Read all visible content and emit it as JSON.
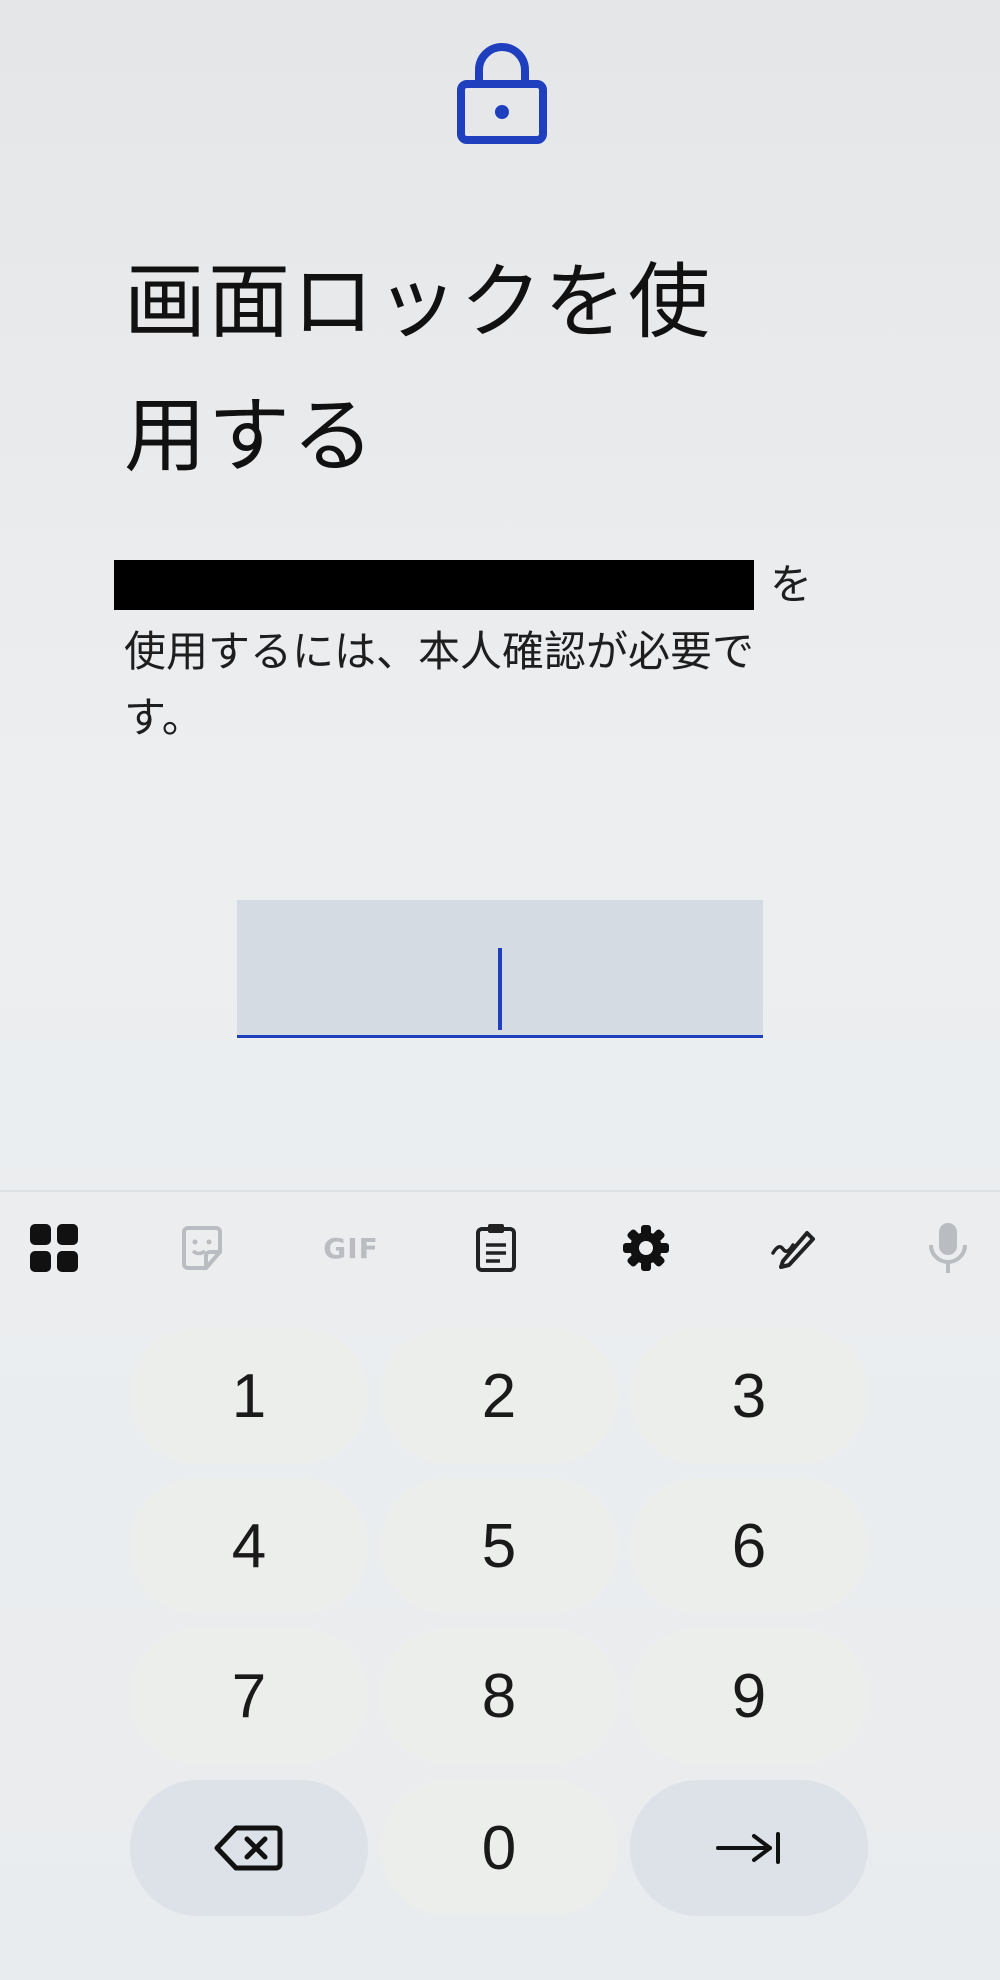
{
  "header": {
    "lock_icon": "lock-icon",
    "title_line1": "画面ロックを使",
    "title_line2": "用する"
  },
  "description": {
    "redacted_app_name": "",
    "suffix": "を",
    "line2": "使用するには、本人確認が必要で",
    "line3": "す。"
  },
  "pin_input": {
    "value": "",
    "accent_color": "#1f3fbf"
  },
  "keyboard": {
    "toolbar": [
      {
        "icon": "apps-grid-icon"
      },
      {
        "icon": "sticker-icon"
      },
      {
        "label": "GIF"
      },
      {
        "icon": "clipboard-icon"
      },
      {
        "icon": "gear-icon"
      },
      {
        "icon": "handwriting-icon"
      },
      {
        "icon": "microphone-icon"
      }
    ],
    "keys": {
      "k1": "1",
      "k2": "2",
      "k3": "3",
      "k4": "4",
      "k5": "5",
      "k6": "6",
      "k7": "7",
      "k8": "8",
      "k9": "9",
      "k0": "0"
    },
    "backspace_icon": "backspace-icon",
    "next_icon": "tab-next-icon"
  }
}
